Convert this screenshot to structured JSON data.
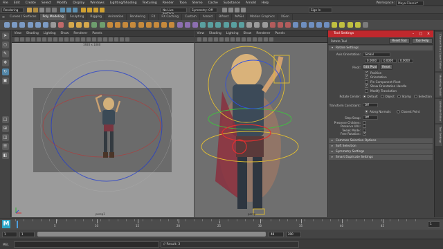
{
  "menubar": {
    "items": [
      "File",
      "Edit",
      "Create",
      "Select",
      "Modify",
      "Display",
      "Windows",
      "Lighting/Shading",
      "Texturing",
      "Render",
      "Toon",
      "Stereo",
      "Cache",
      "Substance",
      "Arnold",
      "Help"
    ],
    "workspace_label": "Workspace:",
    "workspace_value": "Maya Classic*"
  },
  "statusline": {
    "menuset": "Rendering",
    "live_surface": "No Live Surface",
    "symmetry": "Symmetry: Off",
    "sign_in": "Sign In"
  },
  "shelf": {
    "tabs": [
      "Curves / Surfaces",
      "Poly Modeling",
      "Sculpting",
      "Rigging",
      "Animation",
      "Rendering",
      "FX",
      "FX Caching",
      "Custom",
      "Arnold",
      "Bifrost",
      "MASH",
      "Motion Graphics",
      "XGen"
    ],
    "active_tab": "Poly Modeling"
  },
  "viewport_left": {
    "menus": [
      "View",
      "Shading",
      "Lighting",
      "Show",
      "Renderer",
      "Panels"
    ],
    "resolution": "1920 x 1080",
    "camera": "persp1"
  },
  "viewport_right": {
    "menus": [
      "View",
      "Shading",
      "Lighting",
      "Show",
      "Renderer",
      "Panels"
    ],
    "camera": "persp"
  },
  "tool_settings": {
    "window_title": "Tool Settings",
    "tool_name": "Rotate Tool",
    "reset_button": "Reset Tool",
    "help_button": "Tool Help",
    "section_rotate": "Rotate Settings",
    "axis_orientation_label": "Axis Orientation:",
    "axis_orientation_value": "Global",
    "axis_x": "0.0000",
    "axis_y": "0.0000",
    "axis_z": "0.0000",
    "pivot_label": "Pivot:",
    "edit_pivot": "Edit Pivot",
    "reset_pivot": "Reset",
    "pivot_checks": [
      {
        "label": "Position",
        "checked": true
      },
      {
        "label": "Orientation",
        "checked": true
      },
      {
        "label": "Pin Component Pivot",
        "checked": false
      },
      {
        "label": "Show Orientation Handle",
        "checked": true
      },
      {
        "label": "Modify Translation",
        "checked": false
      }
    ],
    "rotate_center_label": "Rotate Center:",
    "rotate_center_options": [
      "Default",
      "Object",
      "Stamp",
      "Selection"
    ],
    "transform_constraint_label": "Transform Constraint:",
    "transform_constraint_value": "Off",
    "along_normals": "Along Normals",
    "nearest_point": "Closest Point",
    "step_snap_label": "Step Snap:",
    "step_snap_value": "Off",
    "preserve_children": "Preserve Children:",
    "preserve_uvs": "Preserve UVs:",
    "tweak_mode": "Tweak Mode:",
    "free_rotation": "Free Rotation:",
    "collapsed_sections": [
      "Common Selection Options",
      "Soft Selection",
      "Symmetry Settings",
      "Smart Duplicate Settings"
    ]
  },
  "right_strip_tabs": [
    "Channel Box / Layer Editor",
    "Modeling Toolkit",
    "Attribute Editor",
    "Tool Settings"
  ],
  "timeline": {
    "current_frame": "1",
    "range_start": "1",
    "range_inner_start": "1",
    "range_inner_end": "48",
    "range_end": "200",
    "ticks": [
      "5",
      "10",
      "15",
      "20",
      "25",
      "30",
      "35",
      "40",
      "45"
    ]
  },
  "command_line": {
    "language": "MEL",
    "result": "// Result: 3"
  },
  "colors": {
    "accent_red": "#c0282d",
    "selection_blue": "#5285a6",
    "maya_logo": "#22a7c8"
  }
}
